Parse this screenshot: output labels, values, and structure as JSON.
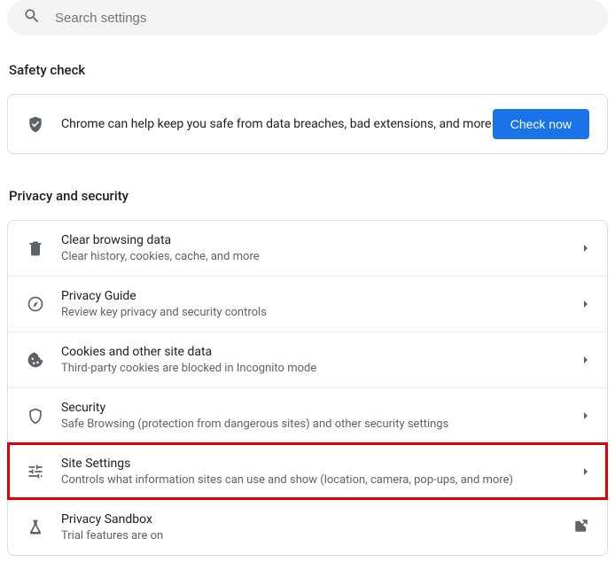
{
  "search": {
    "placeholder": "Search settings"
  },
  "safety": {
    "heading": "Safety check",
    "text": "Chrome can help keep you safe from data breaches, bad extensions, and more",
    "button": "Check now"
  },
  "privacy": {
    "heading": "Privacy and security",
    "items": [
      {
        "title": "Clear browsing data",
        "sub": "Clear history, cookies, cache, and more"
      },
      {
        "title": "Privacy Guide",
        "sub": "Review key privacy and security controls"
      },
      {
        "title": "Cookies and other site data",
        "sub": "Third-party cookies are blocked in Incognito mode"
      },
      {
        "title": "Security",
        "sub": "Safe Browsing (protection from dangerous sites) and other security settings"
      },
      {
        "title": "Site Settings",
        "sub": "Controls what information sites can use and show (location, camera, pop-ups, and more)"
      },
      {
        "title": "Privacy Sandbox",
        "sub": "Trial features are on"
      }
    ]
  }
}
